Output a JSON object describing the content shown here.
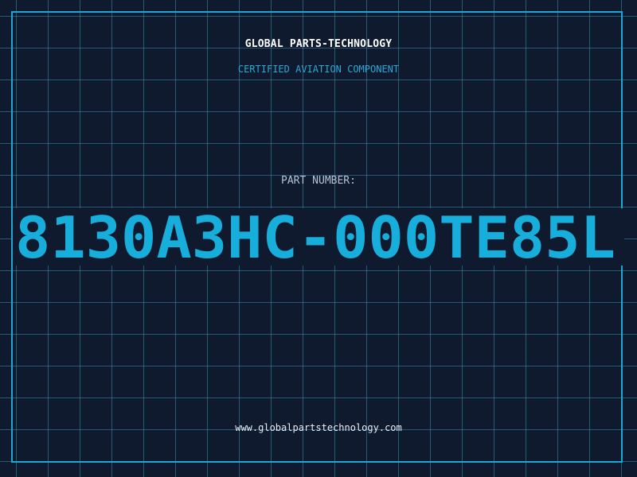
{
  "header": {
    "company": "GLOBAL PARTS-TECHNOLOGY",
    "subtitle": "CERTIFIED AVIATION COMPONENT"
  },
  "part": {
    "label": "PART NUMBER:",
    "number": "8130A3HC-000TE85L"
  },
  "footer": {
    "url": "www.globalpartstechnology.com"
  },
  "colors": {
    "background": "#101a2e",
    "grid": "#2f7ea3",
    "accent": "#1da7d6",
    "part_number": "#18aedc"
  }
}
